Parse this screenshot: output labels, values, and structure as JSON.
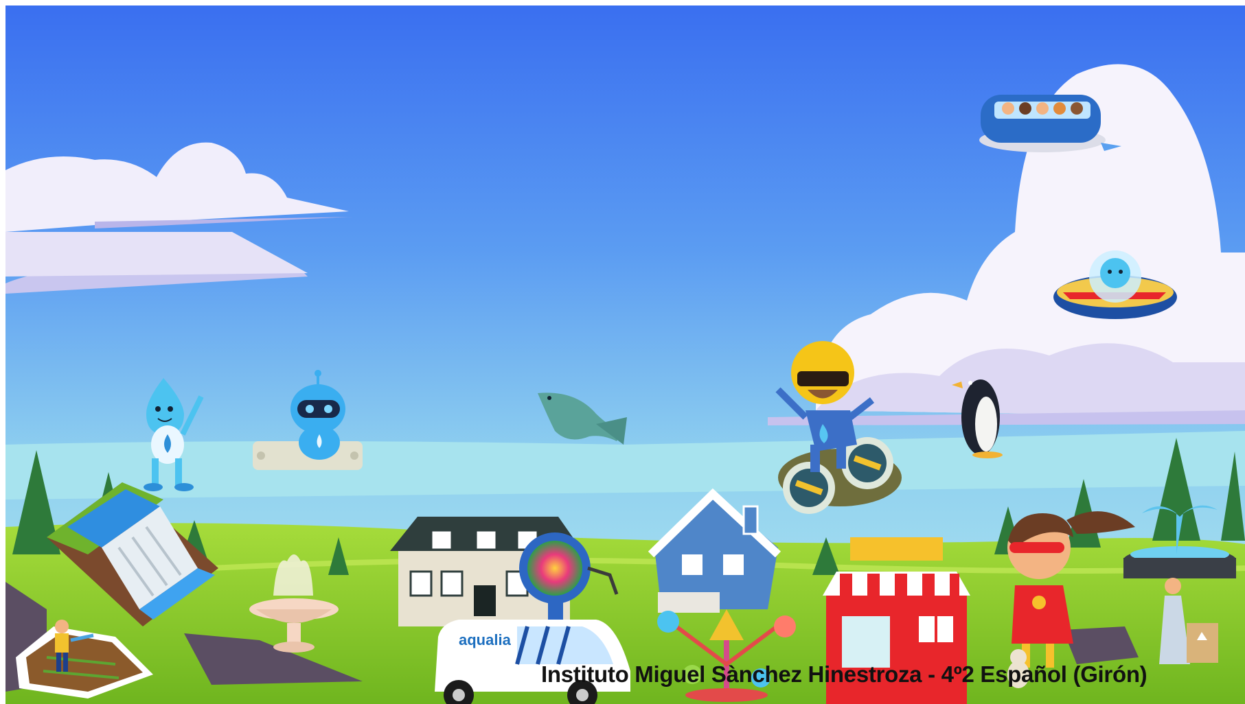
{
  "scene": {
    "caption": "Instituto Miguel Sànchez Hinestroza  - 4º2 Español (Girón)",
    "van_brand": "aqualia",
    "colors": {
      "sky_top": "#3c74f2",
      "sky_bottom": "#a8e2ef",
      "grass": "#8ccf2a",
      "water_mascot": "#4cc3f0",
      "store_red": "#e8262b",
      "house_blue": "#4f86c9"
    },
    "characters": [
      {
        "name": "water-drop-mascot",
        "icon": "water-drop-character"
      },
      {
        "name": "robot-mascot",
        "icon": "robot-character"
      },
      {
        "name": "dolphin",
        "icon": "dolphin"
      },
      {
        "name": "hoverboard-hero",
        "icon": "hero-character"
      },
      {
        "name": "penguin",
        "icon": "penguin"
      },
      {
        "name": "flying-bus",
        "icon": "flying-bus"
      },
      {
        "name": "ufo-drop",
        "icon": "ufo"
      },
      {
        "name": "superhero-girl",
        "icon": "superhero-girl"
      },
      {
        "name": "gardener",
        "icon": "gardener"
      },
      {
        "name": "woman-recycling",
        "icon": "woman-recycling"
      }
    ],
    "places": [
      {
        "name": "dam",
        "icon": "dam"
      },
      {
        "name": "fountain-left",
        "icon": "fountain"
      },
      {
        "name": "mansion",
        "icon": "house"
      },
      {
        "name": "blue-house",
        "icon": "house"
      },
      {
        "name": "carousel",
        "icon": "carousel"
      },
      {
        "name": "red-store",
        "icon": "store"
      },
      {
        "name": "fountain-right",
        "icon": "fountain"
      },
      {
        "name": "delivery-van",
        "icon": "van"
      }
    ]
  }
}
